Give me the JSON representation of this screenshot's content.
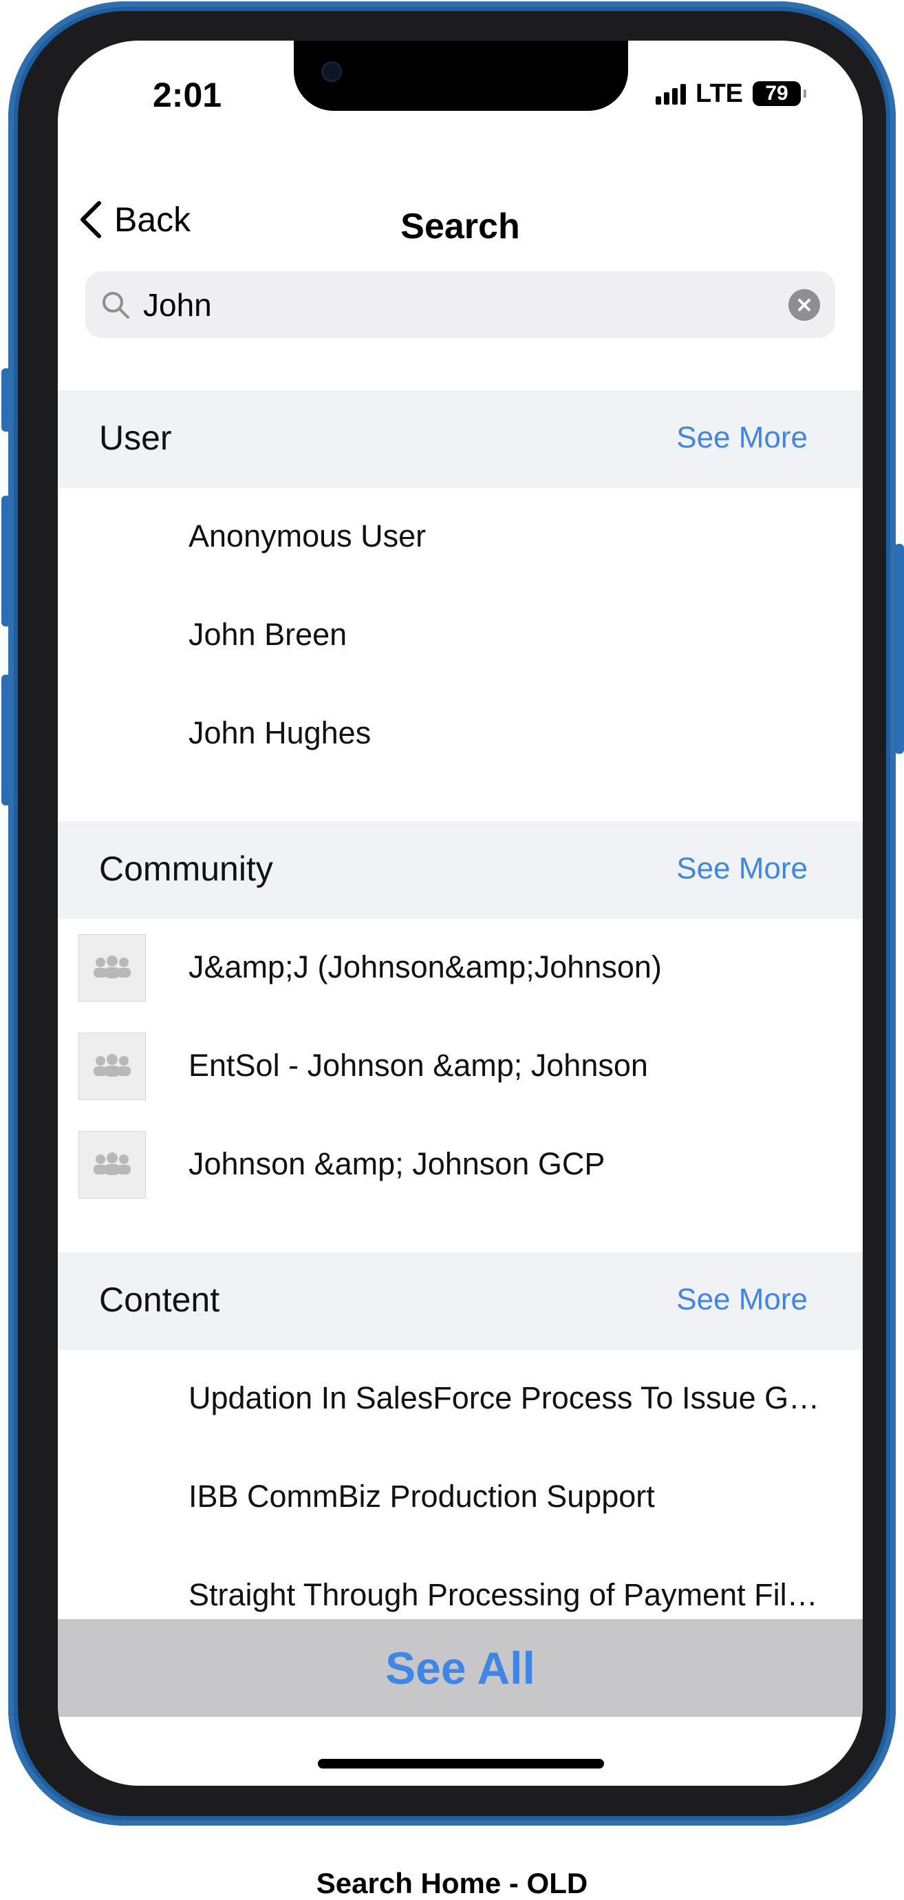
{
  "status_bar": {
    "time": "2:01",
    "network": "LTE",
    "battery": "79"
  },
  "nav": {
    "back_label": "Back",
    "title": "Search"
  },
  "search": {
    "value": "John",
    "placeholder": ""
  },
  "sections": [
    {
      "title": "User",
      "see_more": "See More",
      "items": [
        "Anonymous User",
        "John Breen",
        "John Hughes"
      ]
    },
    {
      "title": "Community",
      "see_more": "See More",
      "items": [
        "J&amp;J (Johnson&amp;Johnson)",
        "EntSol - Johnson &amp; Johnson",
        "Johnson &amp; Johnson GCP"
      ]
    },
    {
      "title": "Content",
      "see_more": "See More",
      "items": [
        "Updation In SalesForce Process To Issue G…",
        "IBB CommBiz Production Support",
        "Straight Through Processing of Payment Fil…"
      ]
    }
  ],
  "footer": {
    "see_all_label": "See All"
  },
  "caption": "Search Home - OLD",
  "colors": {
    "accent": "#3f86e6",
    "section_bg": "#f1f2f5",
    "phone_frame": "#2f6fb0"
  },
  "icons": {
    "back": "chevron-left-icon",
    "search": "magnifier-icon",
    "clear": "clear-x-icon",
    "community": "group-icon"
  }
}
